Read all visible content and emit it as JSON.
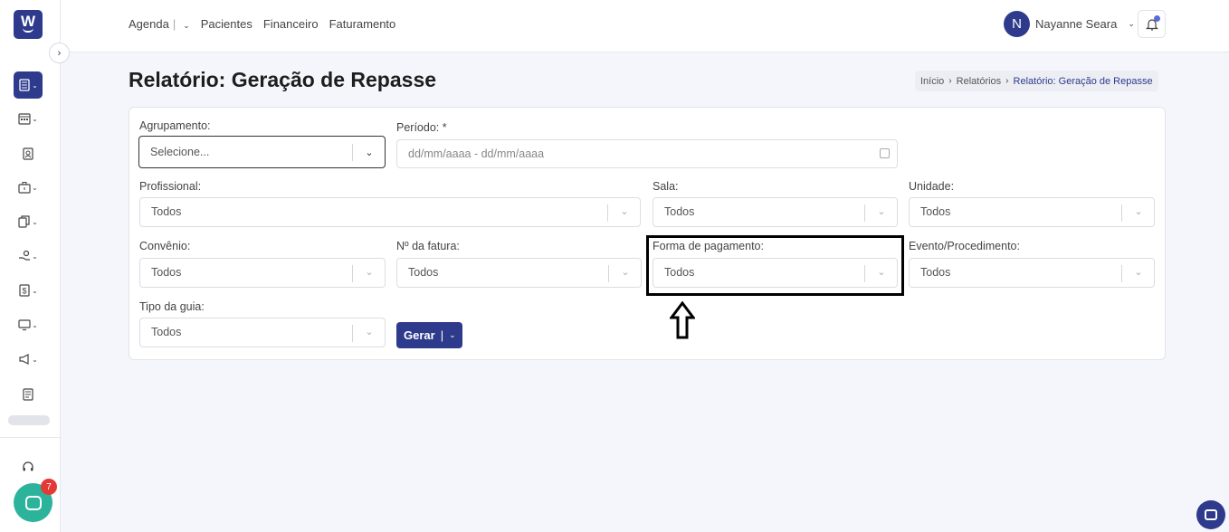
{
  "sidebar": {
    "logo_letter": "W",
    "collapse_icon": "›",
    "chat_badge": "7"
  },
  "topnav": {
    "items": [
      "Agenda",
      "Pacientes",
      "Financeiro",
      "Faturamento"
    ],
    "separator": "|"
  },
  "user": {
    "initial": "N",
    "name": "Nayanne Seara"
  },
  "page": {
    "title": "Relatório: Geração de Repasse"
  },
  "breadcrumb": {
    "items": [
      "Início",
      "Relatórios",
      "Relatório: Geração de Repasse"
    ]
  },
  "form": {
    "agrupamento": {
      "label": "Agrupamento:",
      "value": "Selecione..."
    },
    "periodo": {
      "label": "Período: *",
      "placeholder": "dd/mm/aaaa - dd/mm/aaaa"
    },
    "profissional": {
      "label": "Profissional:",
      "value": "Todos"
    },
    "sala": {
      "label": "Sala:",
      "value": "Todos"
    },
    "unidade": {
      "label": "Unidade:",
      "value": "Todos"
    },
    "convenio": {
      "label": "Convênio:",
      "value": "Todos"
    },
    "fatura": {
      "label": "Nº da fatura:",
      "value": "Todos"
    },
    "forma_pagamento": {
      "label": "Forma de pagamento:",
      "value": "Todos"
    },
    "evento": {
      "label": "Evento/Procedimento:",
      "value": "Todos"
    },
    "tipo_guia": {
      "label": "Tipo da guia:",
      "value": "Todos"
    },
    "gerar_label": "Gerar"
  },
  "colors": {
    "primary": "#2e3a8c",
    "chat": "#2bb39b",
    "badge": "#e53935"
  }
}
